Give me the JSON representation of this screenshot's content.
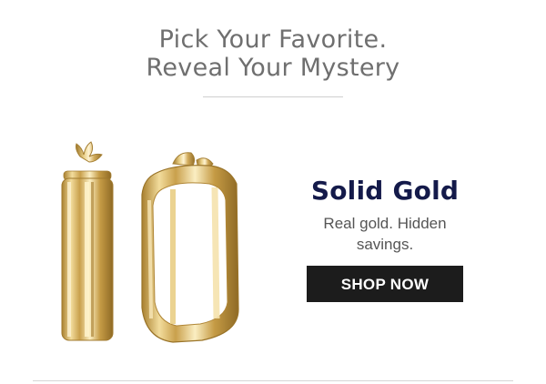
{
  "headline": {
    "line1": "Pick Your Favorite.",
    "line2": "Reveal Your Mystery"
  },
  "product": {
    "image_icon": "gold-hoop-earrings-icon"
  },
  "promo": {
    "title": "Solid Gold",
    "subtitle": "Real gold. Hidden savings.",
    "cta_label": "SHOP NOW"
  },
  "colors": {
    "headline": "#6f6f6f",
    "title": "#141a4a",
    "button_bg": "#1c1c1c",
    "gold": "#d9b568"
  }
}
